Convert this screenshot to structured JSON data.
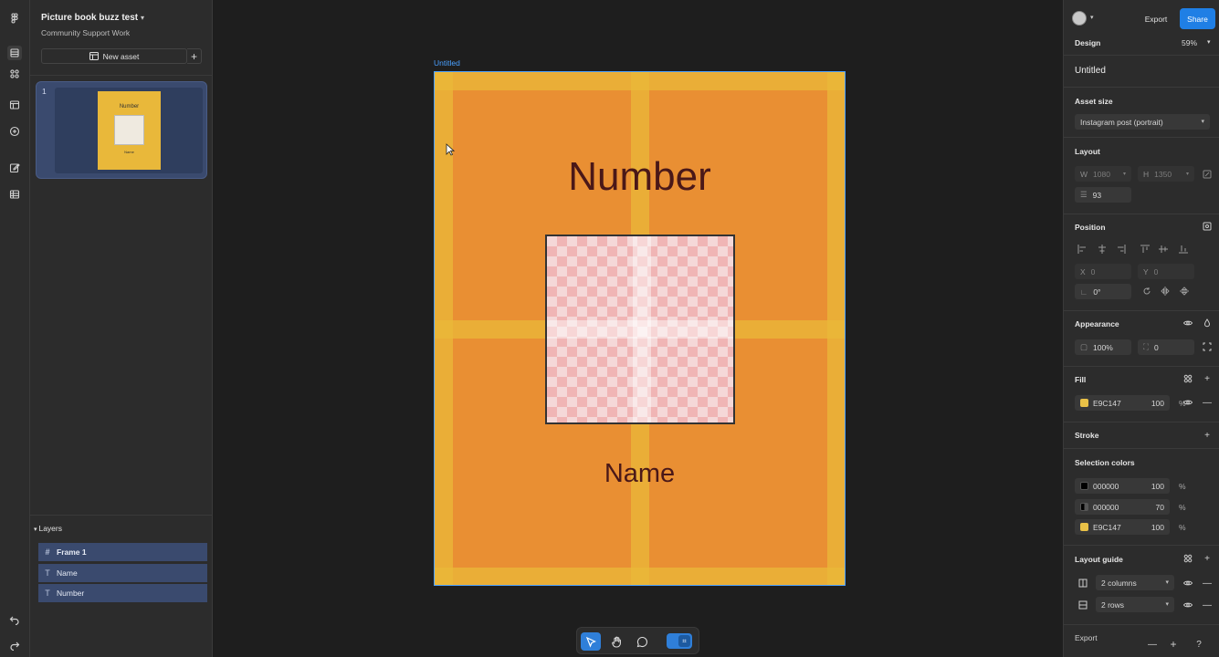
{
  "project": {
    "title": "Picture book buzz test",
    "subtitle": "Community Support Work",
    "new_asset_label": "New asset"
  },
  "pages": [
    {
      "number": "1"
    }
  ],
  "thumbnail": {
    "title": "Number",
    "name": "Name"
  },
  "layers": {
    "header": "Layers",
    "items": [
      "Frame 1",
      "Name",
      "Number"
    ]
  },
  "canvas": {
    "frame_label": "Untitled",
    "number_text": "Number",
    "name_text": "Name"
  },
  "header": {
    "export_label": "Export",
    "share_label": "Share"
  },
  "design": {
    "label": "Design",
    "zoom": "59%"
  },
  "asset": {
    "name": "Untitled",
    "size_label": "Asset size",
    "size_value": "Instagram post (portrait)"
  },
  "layout": {
    "label": "Layout",
    "w_label": "W",
    "w": "1080",
    "h_label": "H",
    "h": "1350",
    "radius": "93"
  },
  "position": {
    "label": "Position",
    "x_label": "X",
    "x": "0",
    "y_label": "Y",
    "y": "0",
    "rotation": "0°"
  },
  "appearance": {
    "label": "Appearance",
    "opacity": "100%",
    "corner": "0"
  },
  "fill": {
    "label": "Fill",
    "color": "E9C147",
    "color_hex": "#E9C147",
    "opacity": "100",
    "unit": "%"
  },
  "stroke": {
    "label": "Stroke"
  },
  "selection_colors": {
    "label": "Selection colors",
    "items": [
      {
        "hex": "000000",
        "swatch": "#000000",
        "opacity": "100",
        "unit": "%"
      },
      {
        "hex": "000000",
        "swatch": "#000000",
        "opacity": "70",
        "unit": "%"
      },
      {
        "hex": "E9C147",
        "swatch": "#E9C147",
        "opacity": "100",
        "unit": "%"
      }
    ]
  },
  "layout_guide": {
    "label": "Layout guide",
    "columns": "2 columns",
    "rows": "2 rows"
  },
  "export_section": {
    "label": "Export"
  },
  "colors": {
    "accent": "#1F7FE5",
    "frame_fill": "#E98F33",
    "guide": "#E9B83A",
    "selection": "#3A4A6E"
  }
}
